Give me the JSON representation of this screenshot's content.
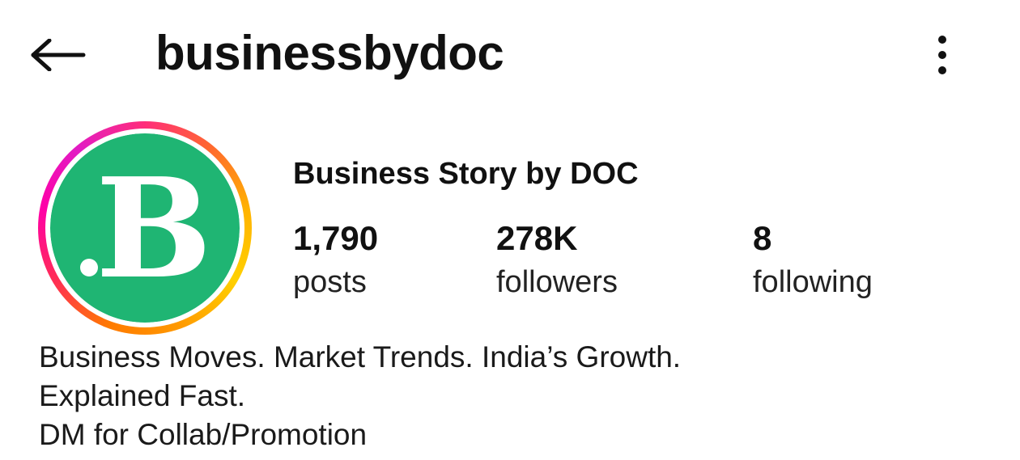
{
  "header": {
    "back_icon": "arrow-left-icon",
    "username": "businessbydoc",
    "more_icon": "more-vertical-icon"
  },
  "profile": {
    "avatar_letter": "B",
    "avatar_bg_color": "#1FB573",
    "avatar_ring_colors": [
      "#ff00a6",
      "#ff2d55",
      "#ff7a00",
      "#ffd000"
    ],
    "display_name": "Business Story by DOC"
  },
  "stats": {
    "posts": {
      "value": "1,790",
      "label": "posts"
    },
    "followers": {
      "value": "278K",
      "label": "followers"
    },
    "following": {
      "value": "8",
      "label": "following"
    }
  },
  "bio": {
    "lines": [
      "Business Moves. Market Trends. India’s Growth.",
      "Explained Fast.",
      "DM for Collab/Promotion"
    ]
  }
}
